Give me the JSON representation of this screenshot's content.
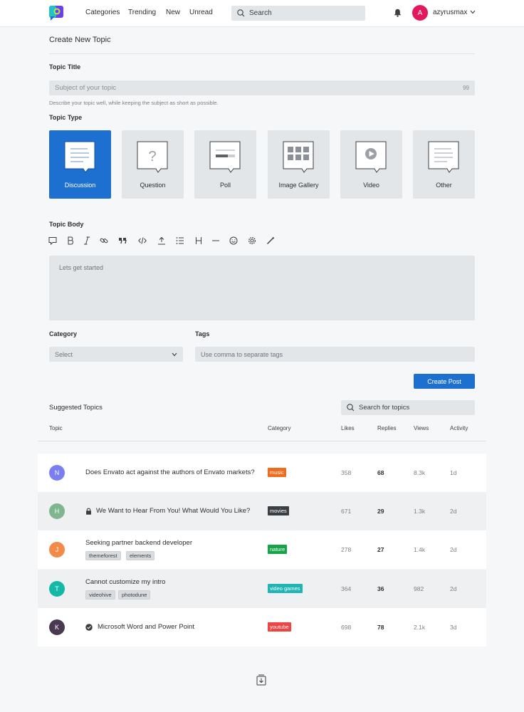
{
  "header": {
    "nav": [
      "Categories",
      "Trending",
      "New",
      "Unread"
    ],
    "search_placeholder": "Search",
    "avatar_initial": "A",
    "avatar_color": "#e4185c",
    "username": "azyrusmax"
  },
  "form": {
    "page_title": "Create New Topic",
    "topic_title_label": "Topic Title",
    "title_placeholder": "Subject of your topic",
    "char_count": "99",
    "hint": "Describe your topic well, while keeping the subject as short as possible.",
    "topic_type_label": "Topic Type",
    "types": [
      {
        "label": "Discussion",
        "icon": "discussion-icon",
        "active": true
      },
      {
        "label": "Question",
        "icon": "question-icon",
        "active": false
      },
      {
        "label": "Poll",
        "icon": "poll-icon",
        "active": false
      },
      {
        "label": "Image Gallery",
        "icon": "image-gallery-icon",
        "active": false
      },
      {
        "label": "Video",
        "icon": "video-icon",
        "active": false
      },
      {
        "label": "Other",
        "icon": "other-icon",
        "active": false
      }
    ],
    "topic_body_label": "Topic Body",
    "toolbar_icons": [
      "comment-icon",
      "bold-icon",
      "italic-icon",
      "link-icon",
      "quote-icon",
      "code-icon",
      "upload-icon",
      "list-icon",
      "heading-icon",
      "horizontal-rule-icon",
      "emoji-icon",
      "settings-icon",
      "pen-icon"
    ],
    "body_placeholder": "Lets get started",
    "category_label": "Category",
    "category_selected": "Select",
    "tags_label": "Tags",
    "tags_placeholder": "Use comma to separate tags",
    "submit_label": "Create Post"
  },
  "suggested": {
    "title": "Suggested Topics",
    "search_placeholder": "Search for topics",
    "columns": [
      "Topic",
      "Category",
      "Likes",
      "Replies",
      "Views",
      "Activity"
    ],
    "rows": [
      {
        "initial": "N",
        "avatar_color": "#7a7ef0",
        "title": "Does Envato act against the authors of Envato markets?",
        "prefix_icon": "",
        "tags": [],
        "category": "music",
        "category_color": "#ef6b1d",
        "likes": "358",
        "replies": "68",
        "views": "8.3k",
        "activity": "1d"
      },
      {
        "initial": "H",
        "avatar_color": "#7fb58f",
        "title": "We Want to Hear From You! What Would You Like?",
        "prefix_icon": "lock-icon",
        "tags": [],
        "category": "movies",
        "category_color": "#3a3f44",
        "likes": "671",
        "replies": "29",
        "views": "1.3k",
        "activity": "2d"
      },
      {
        "initial": "J",
        "avatar_color": "#f28a4a",
        "title": "Seeking partner backend developer",
        "prefix_icon": "",
        "tags": [
          "themeforest",
          "elements"
        ],
        "category": "nature",
        "category_color": "#16a34a",
        "likes": "278",
        "replies": "27",
        "views": "1.4k",
        "activity": "2d"
      },
      {
        "initial": "T",
        "avatar_color": "#14b8a6",
        "title": "Cannot customize my intro",
        "prefix_icon": "",
        "tags": [
          "videohive",
          "photodune"
        ],
        "category": "video games",
        "category_color": "#1fb5b5",
        "likes": "364",
        "replies": "36",
        "views": "982",
        "activity": "2d"
      },
      {
        "initial": "K",
        "avatar_color": "#4a3a4f",
        "title": "Microsoft Word and Power Point",
        "prefix_icon": "check-circle-icon",
        "tags": [],
        "category": "youtube",
        "category_color": "#ef4444",
        "likes": "698",
        "replies": "78",
        "views": "2.1k",
        "activity": "3d"
      }
    ]
  }
}
